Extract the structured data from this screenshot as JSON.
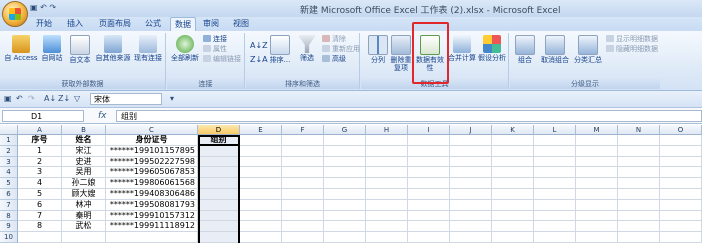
{
  "app": {
    "title": "新建 Microsoft Office Excel 工作表 (2).xlsx - Microsoft Excel"
  },
  "tabs": [
    "开始",
    "插入",
    "页面布局",
    "公式",
    "数据",
    "审阅",
    "视图"
  ],
  "active_tab": "数据",
  "ribbon": {
    "get_external": {
      "label": "获取外部数据",
      "buttons": [
        "自 Access",
        "自网站",
        "自文本",
        "自其他来源",
        "现有连接"
      ]
    },
    "connections": {
      "label": "连接",
      "refresh": "全部刷新",
      "small": [
        "连接",
        "属性",
        "编辑链接"
      ]
    },
    "sort_filter": {
      "label": "排序和筛选",
      "sort": "排序...",
      "filter": "筛选",
      "small": [
        "清除",
        "重新应用",
        "高级"
      ]
    },
    "data_tools": {
      "label": "数据工具",
      "buttons": [
        "分列",
        "删除重复项",
        "数据有效性",
        "合并计算",
        "假设分析"
      ]
    },
    "outline": {
      "label": "分级显示",
      "buttons": [
        "组合",
        "取消组合",
        "分类汇总"
      ],
      "small": [
        "显示明细数据",
        "隐藏明细数据"
      ]
    }
  },
  "quick_access": {
    "font_name": "宋体"
  },
  "formula_bar": {
    "name_box": "D1",
    "fx": "fx",
    "content": "组别"
  },
  "sheet": {
    "columns": [
      "A",
      "B",
      "C",
      "D",
      "E",
      "F",
      "G",
      "H",
      "I",
      "J",
      "K",
      "L",
      "M",
      "N",
      "O"
    ],
    "selected_column": "D",
    "row_numbers": [
      "1",
      "2",
      "3",
      "4",
      "5",
      "6",
      "7",
      "8",
      "9",
      "10"
    ],
    "rows": [
      [
        "序号",
        "姓名",
        "身份证号",
        "组别"
      ],
      [
        "1",
        "宋江",
        "******199101157895",
        ""
      ],
      [
        "2",
        "史进",
        "******199502227598",
        ""
      ],
      [
        "3",
        "吴用",
        "******199605067853",
        ""
      ],
      [
        "4",
        "孙二娘",
        "******199806061568",
        ""
      ],
      [
        "5",
        "顾大嫂",
        "******199408306486",
        ""
      ],
      [
        "6",
        "林冲",
        "******199508081793",
        ""
      ],
      [
        "7",
        "秦明",
        "******199910157312",
        ""
      ],
      [
        "8",
        "武松",
        "******199911118912",
        ""
      ],
      [
        "",
        "",
        "",
        ""
      ]
    ]
  },
  "colors": {
    "highlight_border": "#e3262c",
    "ribbon_blue": "#dbe8f8",
    "selection": "#f7c964"
  }
}
